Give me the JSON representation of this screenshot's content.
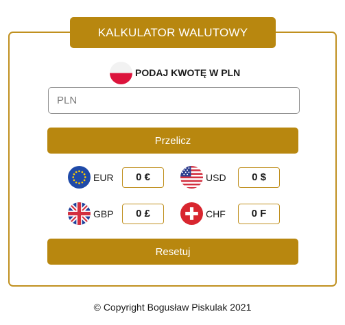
{
  "app": {
    "title": "KALKULATOR WALUTOWY",
    "prompt": "PODAJ KWOTĘ W PLN",
    "prompt_flag": "poland-flag-icon"
  },
  "input": {
    "placeholder": "PLN",
    "value": ""
  },
  "buttons": {
    "convert_label": "Przelicz",
    "reset_label": "Resetuj"
  },
  "currencies": [
    {
      "code": "EUR",
      "value": "0 €",
      "flag": "eu-flag-icon"
    },
    {
      "code": "USD",
      "value": "0 $",
      "flag": "us-flag-icon"
    },
    {
      "code": "GBP",
      "value": "0 £",
      "flag": "uk-flag-icon"
    },
    {
      "code": "CHF",
      "value": "0 F",
      "flag": "swiss-flag-icon"
    }
  ],
  "footer": {
    "copyright": "© Copyright Bogusław Piskulak 2021"
  },
  "colors": {
    "accent": "#b8870f",
    "border": "#c0901f"
  }
}
